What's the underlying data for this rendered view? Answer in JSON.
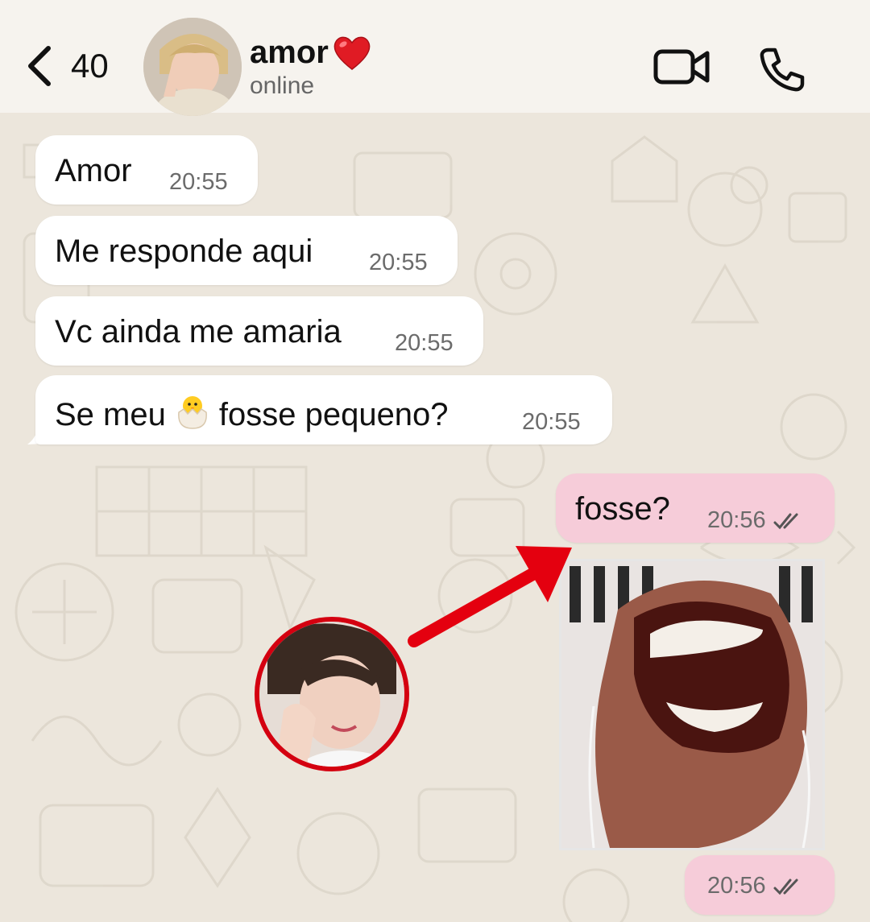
{
  "header": {
    "unread_count": "40",
    "contact_name": "amor",
    "contact_status": "online",
    "icons": [
      "back-chevron-icon",
      "heart-icon",
      "video-call-icon",
      "phone-call-icon"
    ]
  },
  "messages": [
    {
      "direction": "in",
      "text": "Amor",
      "time": "20:55"
    },
    {
      "direction": "in",
      "text": "Me responde aqui",
      "time": "20:55"
    },
    {
      "direction": "in",
      "text": "Vc ainda me amaria",
      "time": "20:55"
    },
    {
      "direction": "in",
      "text_before": "Se meu",
      "emoji": "hatching-chick-emoji",
      "text_after": "fosse pequeno?",
      "time": "20:55"
    },
    {
      "direction": "out",
      "text": "fosse?",
      "time": "20:56",
      "status": "read"
    },
    {
      "direction": "out",
      "type": "image",
      "time": "20:56",
      "status": "read"
    }
  ],
  "colors": {
    "background": "#ece6dc",
    "header": "#f6f3ee",
    "incoming_bubble": "#ffffff",
    "outgoing_bubble": "#f6ccd9",
    "read_ticks": "#555555",
    "annotation_red": "#e4000f"
  }
}
